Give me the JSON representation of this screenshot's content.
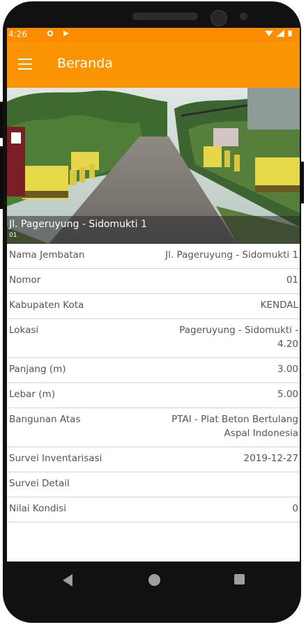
{
  "status_bar": {
    "time": "4:26"
  },
  "app_bar": {
    "title": "Beranda",
    "menu_icon": "hamburger-menu-icon"
  },
  "hero": {
    "title": "Jl. Pageruyung - Sidomukti 1",
    "subtitle": "01"
  },
  "details": [
    {
      "label": "Nama Jembatan",
      "value": "Jl. Pageruyung - Sidomukti 1"
    },
    {
      "label": "Nomor",
      "value": "01"
    },
    {
      "label": "Kabupaten Kota",
      "value": "KENDAL"
    },
    {
      "label": "Lokasi",
      "value": "Pageruyung - Sidomukti - 4.20"
    },
    {
      "label": "Panjang (m)",
      "value": "3.00"
    },
    {
      "label": "Lebar (m)",
      "value": "5.00"
    },
    {
      "label": "Bangunan Atas",
      "value": "PTAI - Plat Beton Bertulang Aspal Indonesia"
    },
    {
      "label": "Survei Inventarisasi",
      "value": "2019-12-27"
    },
    {
      "label": "Survei Detail",
      "value": ""
    },
    {
      "label": "Nilai Kondisi",
      "value": "0"
    }
  ],
  "colors": {
    "accent": "#fb9402",
    "statusbar": "#fb8c00"
  }
}
